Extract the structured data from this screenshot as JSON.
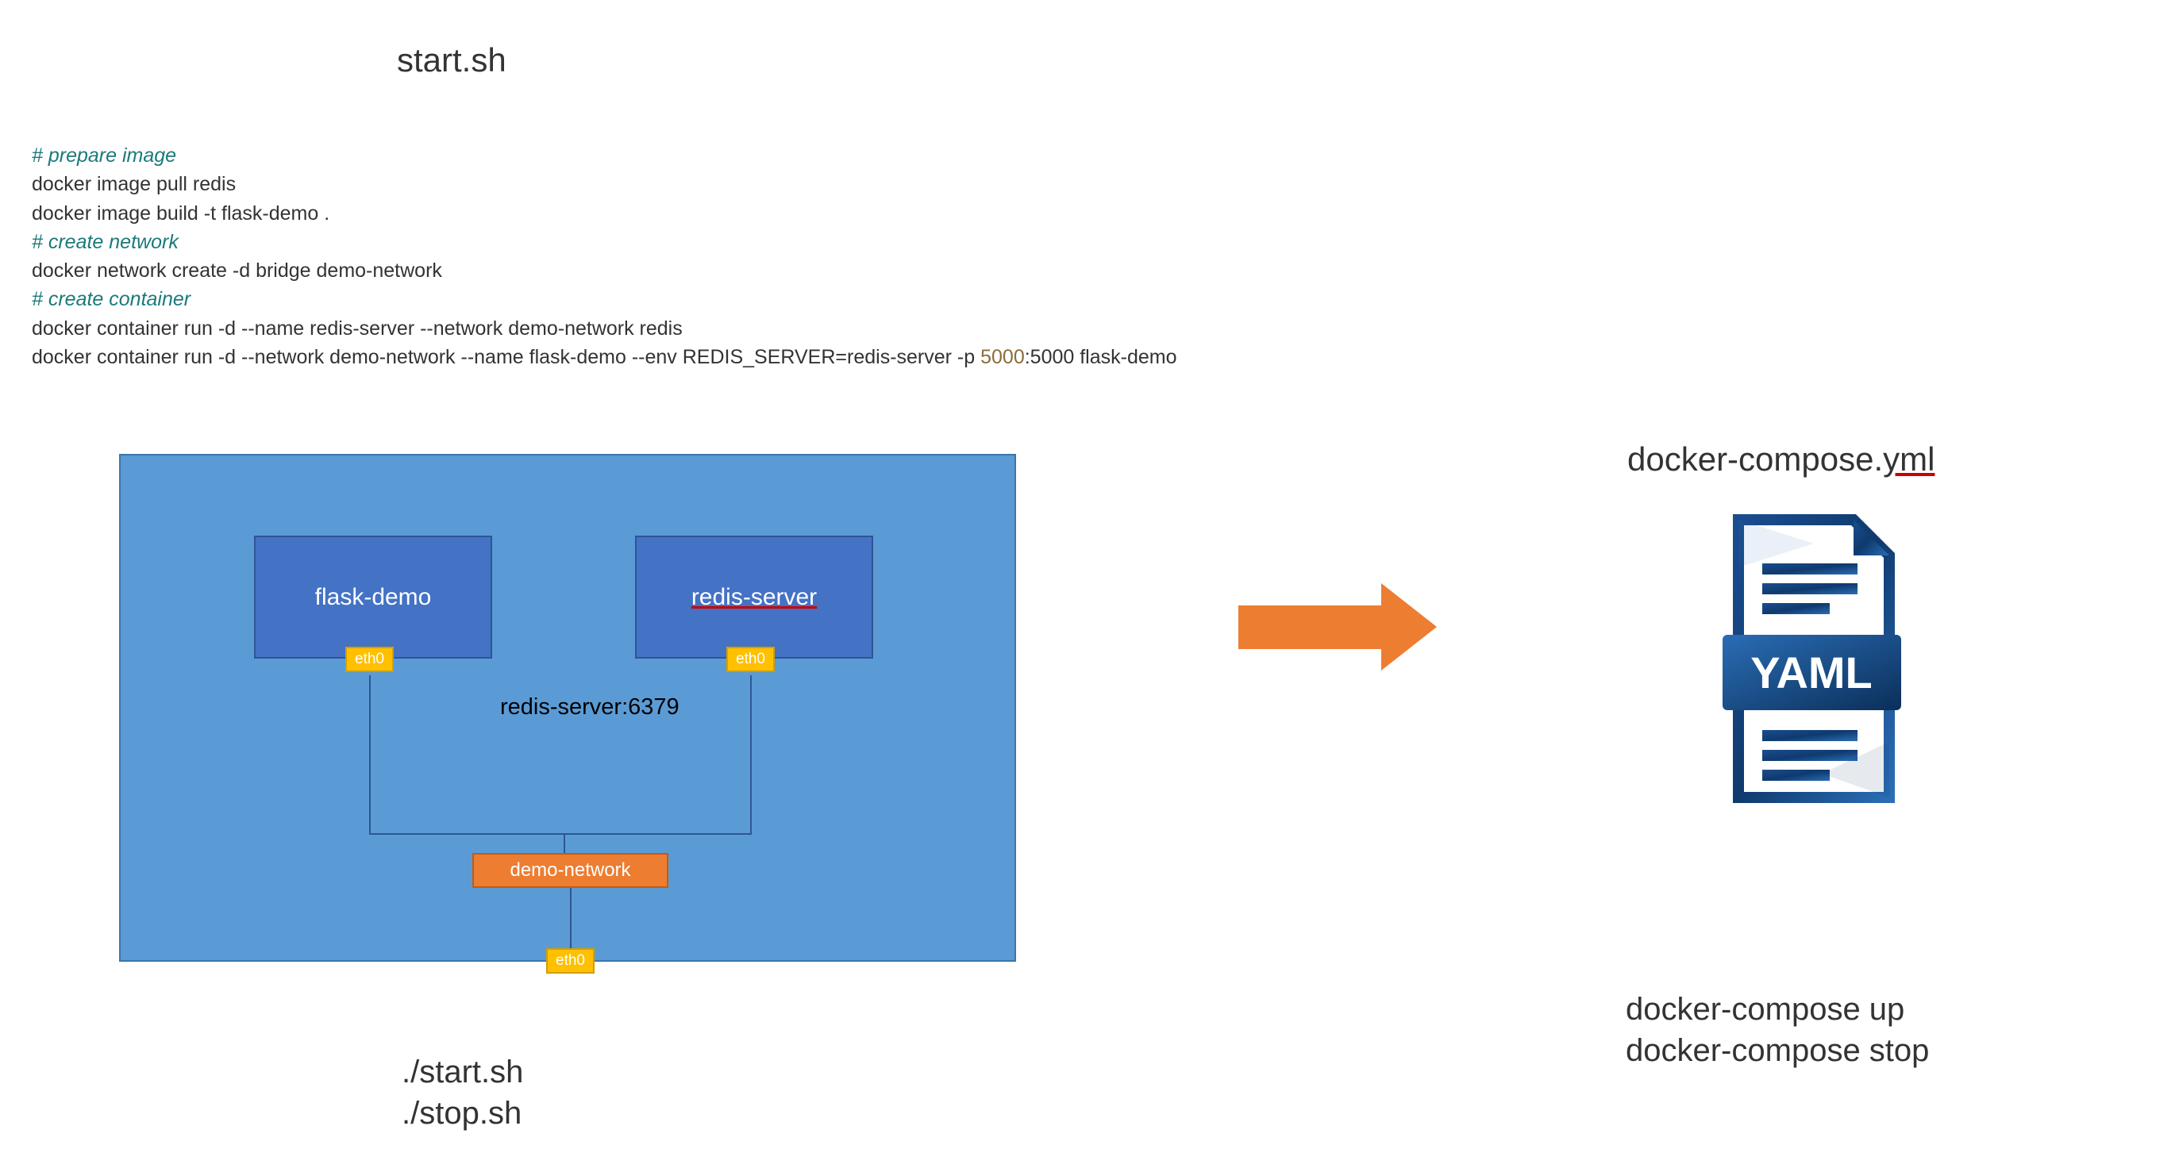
{
  "script": {
    "title": "start.sh",
    "lines": [
      {
        "text": "# prepare image",
        "cls": "comment"
      },
      {
        "text": "docker image pull redis",
        "cls": ""
      },
      {
        "text": "docker image build -t flask-demo .",
        "cls": ""
      },
      {
        "text": "# create network",
        "cls": "comment"
      },
      {
        "text": "docker network create -d bridge demo-network",
        "cls": ""
      },
      {
        "text": "# create container",
        "cls": "comment"
      },
      {
        "text": "docker container run -d --name redis-server --network demo-network redis",
        "cls": ""
      },
      {
        "text": "docker container run -d --network demo-network --name flask-demo --env REDIS_SERVER=redis-server -p 5000:5000 flask-demo",
        "cls": ""
      }
    ]
  },
  "diagram": {
    "container1": "flask-demo",
    "container2": "redis-server",
    "eth_label": "eth0",
    "redis_port": "redis-server:6379",
    "network": "demo-network"
  },
  "left_commands": {
    "line1": "./start.sh",
    "line2": "./stop.sh"
  },
  "right": {
    "filename_pre": "docker-compose.",
    "filename_ext": "yml",
    "yaml_badge": "YAML",
    "cmd1": "docker-compose up",
    "cmd2": "docker-compose stop"
  },
  "colors": {
    "blue_bg": "#5b9bd5",
    "blue_box": "#4472c4",
    "orange": "#ed7d31",
    "yellow": "#ffc000",
    "teal": "#1b7a7a",
    "dark_blue": "#0f3a6e"
  }
}
